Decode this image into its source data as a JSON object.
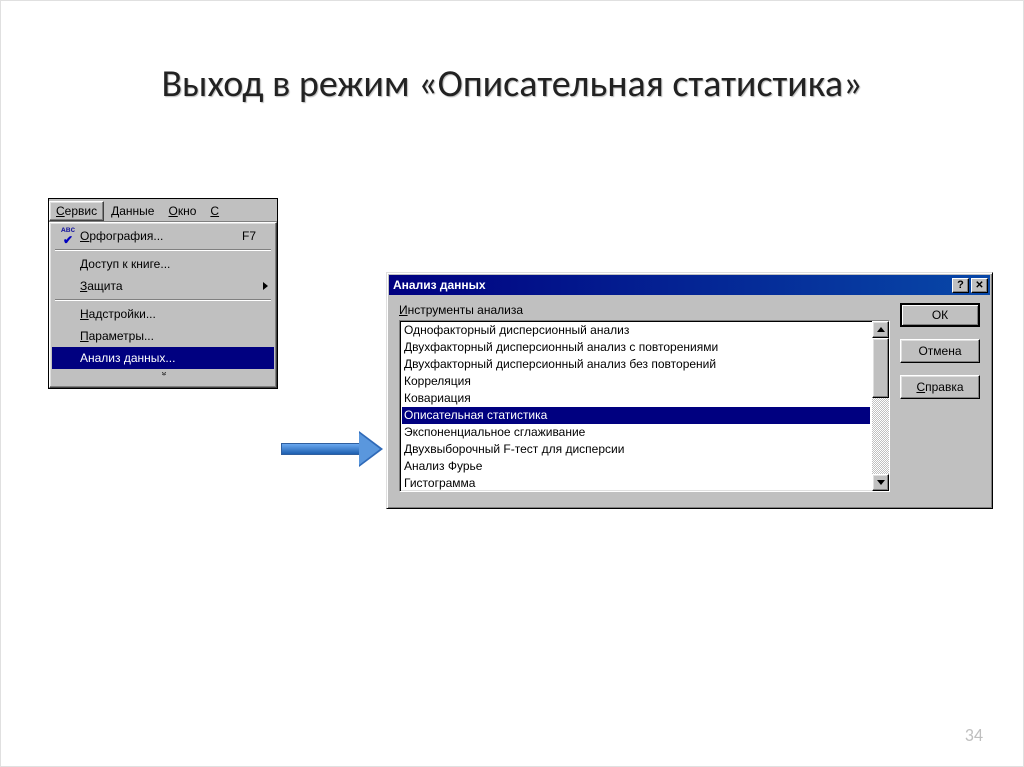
{
  "slide": {
    "title": "Выход в режим «Описательная статистика»",
    "number": "34"
  },
  "menubar": {
    "items": [
      "Сервис",
      "Данные",
      "Окно",
      "С"
    ],
    "active_index": 0
  },
  "dropdown": {
    "items": [
      {
        "label": "Орфография...",
        "shortcut": "F7",
        "icon": "abc-check"
      },
      {
        "sep": true
      },
      {
        "label": "Доступ к книге..."
      },
      {
        "label": "Защита",
        "submenu": true
      },
      {
        "sep": true
      },
      {
        "label": "Надстройки..."
      },
      {
        "label": "Параметры..."
      },
      {
        "label": "Анализ данных...",
        "selected": true
      }
    ]
  },
  "dialog": {
    "title": "Анализ данных",
    "group_label": "Инструменты анализа",
    "list": [
      "Однофакторный дисперсионный анализ",
      "Двухфакторный дисперсионный анализ с повторениями",
      "Двухфакторный дисперсионный анализ без повторений",
      "Корреляция",
      "Ковариация",
      "Описательная статистика",
      "Экспоненциальное сглаживание",
      "Двухвыборочный F-тест для дисперсии",
      "Анализ Фурье",
      "Гистограмма"
    ],
    "selected_index": 5,
    "buttons": {
      "ok": "ОК",
      "cancel": "Отмена",
      "help": "Справка"
    }
  }
}
